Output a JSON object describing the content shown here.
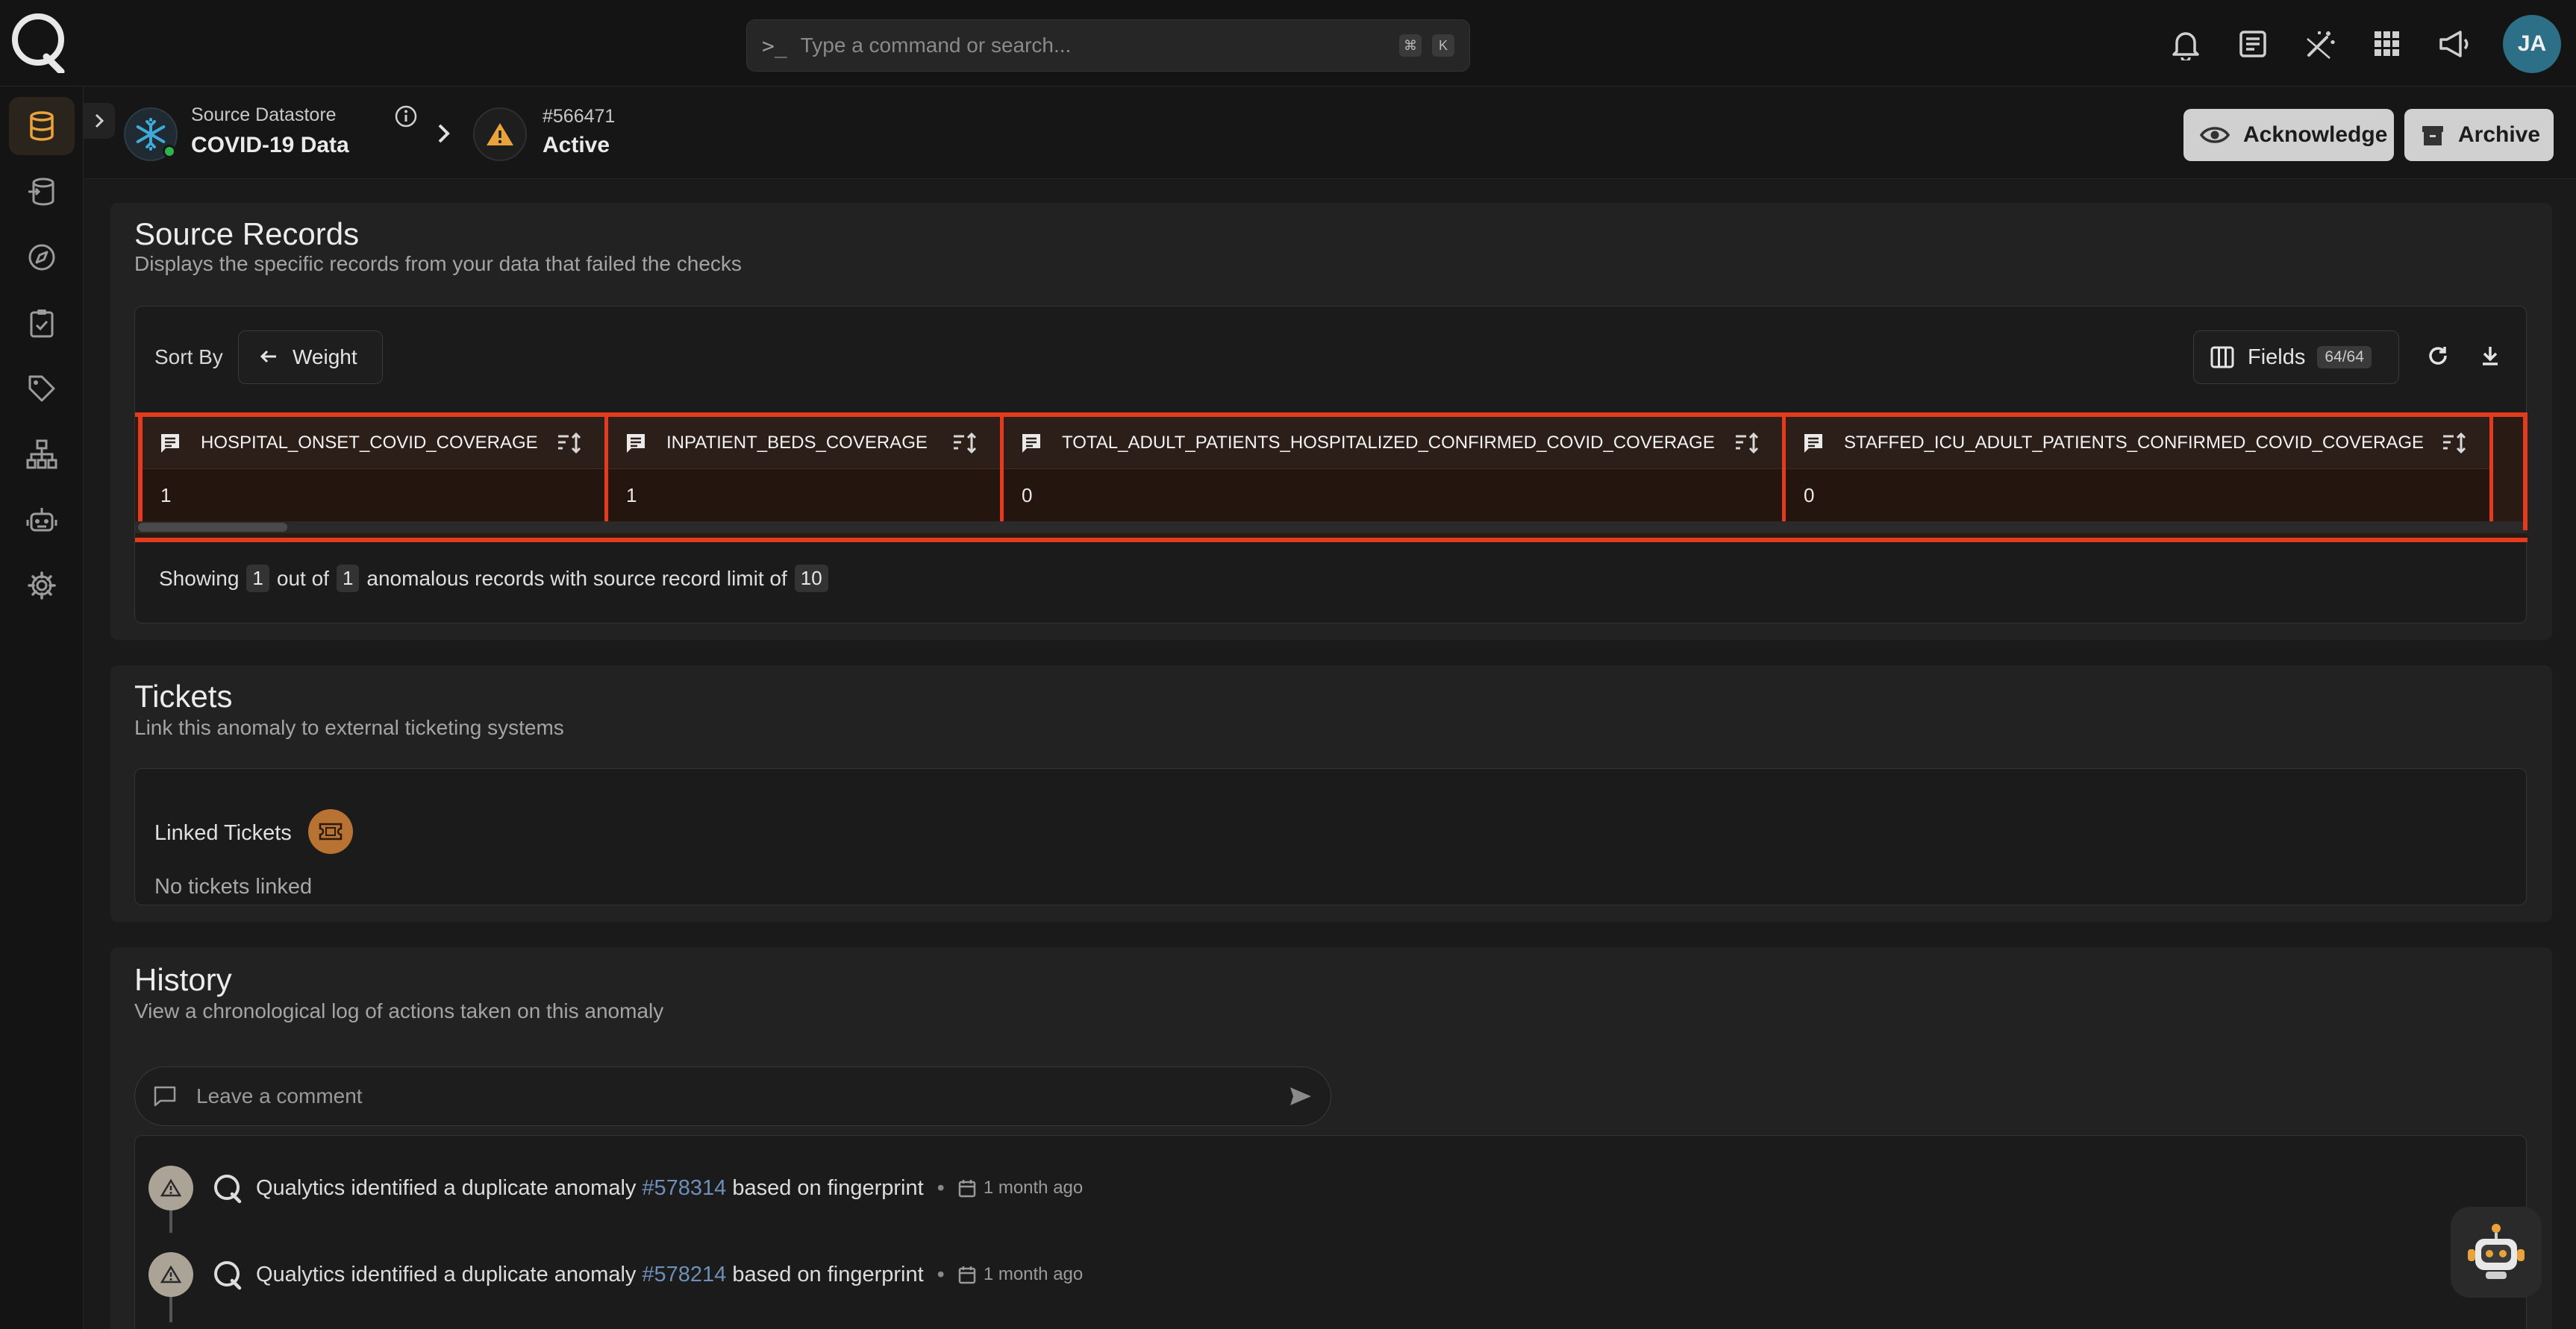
{
  "search": {
    "placeholder": "Type a command or search...",
    "kbd1": "⌘",
    "kbd2": "K"
  },
  "user": {
    "initials": "JA"
  },
  "breadcrumb": {
    "datastore_kicker": "Source Datastore",
    "datastore_name": "COVID-19 Data",
    "anomaly_id": "#566471",
    "anomaly_status": "Active"
  },
  "actions": {
    "acknowledge": "Acknowledge",
    "archive": "Archive"
  },
  "source_records": {
    "title": "Source Records",
    "subtitle": "Displays the specific records from your data that failed the checks",
    "sort_label": "Sort By",
    "sort_value": "Weight",
    "fields_label": "Fields",
    "fields_count": "64/64",
    "columns": [
      "HOSPITAL_ONSET_COVID_COVERAGE",
      "INPATIENT_BEDS_COVERAGE",
      "TOTAL_ADULT_PATIENTS_HOSPITALIZED_CONFIRMED_COVID_COVERAGE",
      "STAFFED_ICU_ADULT_PATIENTS_CONFIRMED_COVID_COVERAGE"
    ],
    "row": [
      "1",
      "1",
      "0",
      "0"
    ],
    "showing_prefix": "Showing",
    "showing_count": "1",
    "showing_mid": "out of",
    "showing_total": "1",
    "showing_suffix": "anomalous records with source record limit of",
    "limit": "10"
  },
  "tickets": {
    "title": "Tickets",
    "subtitle": "Link this anomaly to external ticketing systems",
    "linked_label": "Linked Tickets",
    "empty": "No tickets linked"
  },
  "history": {
    "title": "History",
    "subtitle": "View a chronological log of actions taken on this anomaly",
    "comment_placeholder": "Leave a comment",
    "items": [
      {
        "prefix": "Qualytics identified a duplicate anomaly",
        "link": "#578314",
        "suffix": "based on fingerprint",
        "time": "1 month ago"
      },
      {
        "prefix": "Qualytics identified a duplicate anomaly",
        "link": "#578214",
        "suffix": "based on fingerprint",
        "time": "1 month ago"
      }
    ]
  },
  "colors": {
    "accent": "#e8a33d",
    "highlight": "#e43b1f",
    "link": "#6d8fb8"
  }
}
